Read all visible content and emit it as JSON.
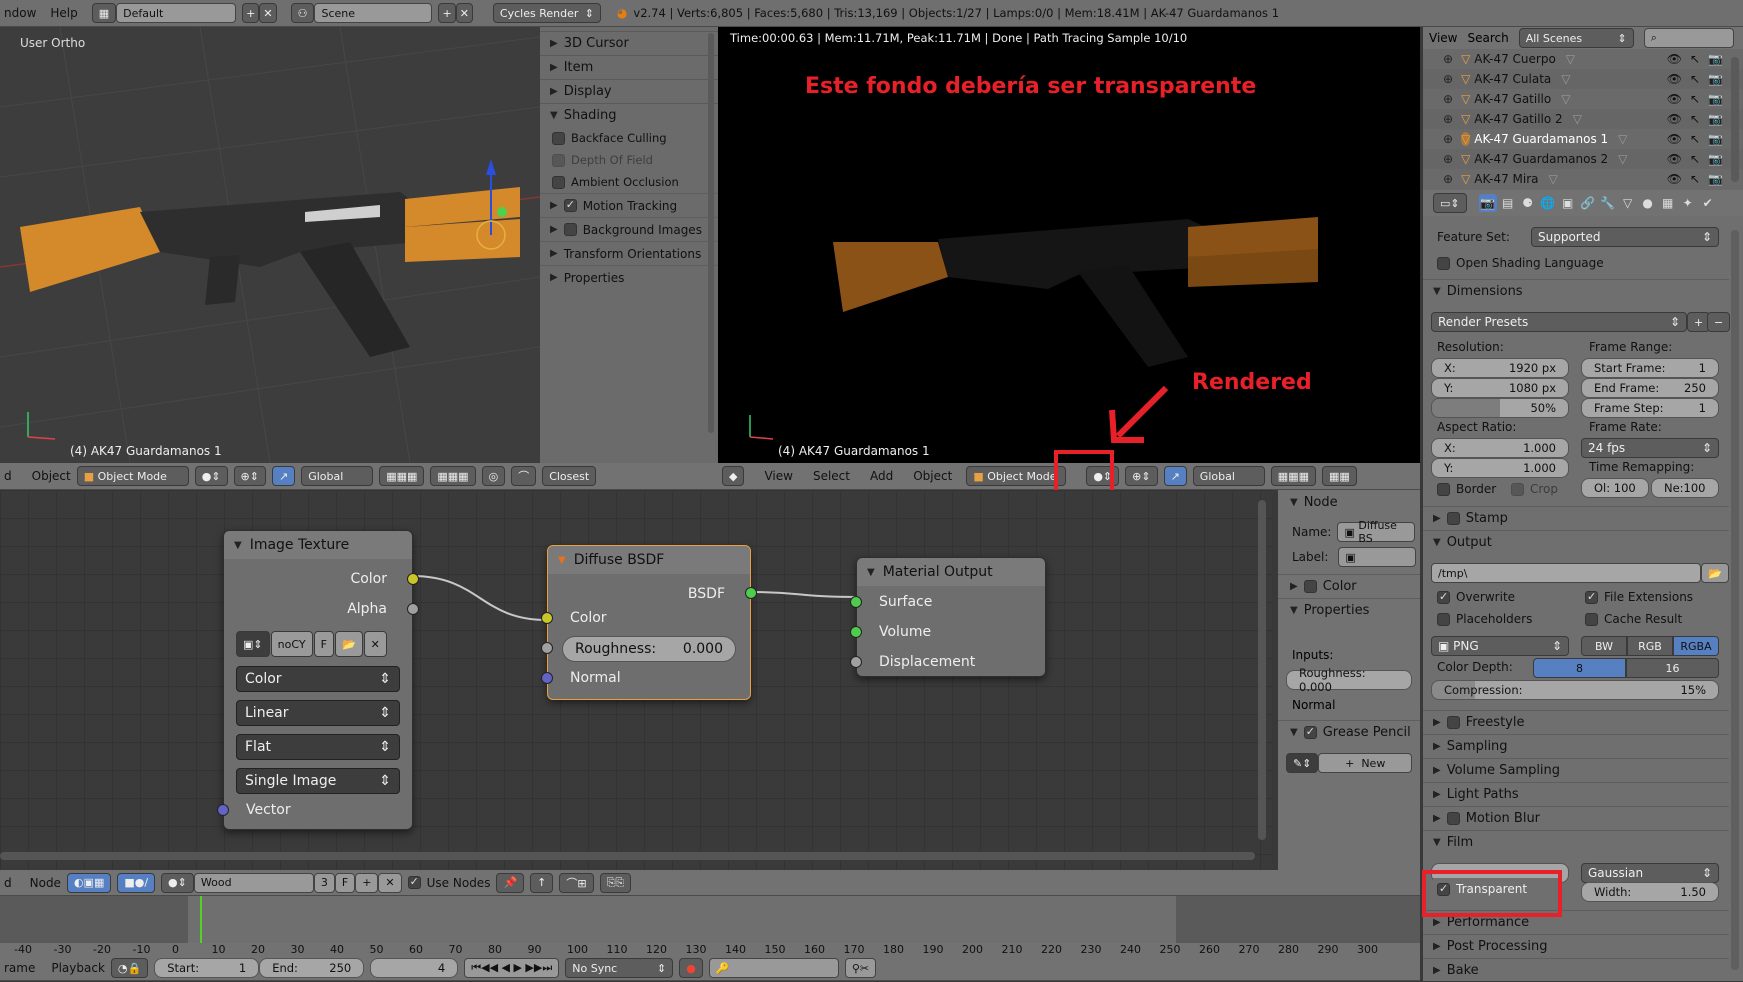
{
  "topbar": {
    "menu": [
      "ndow",
      "Help"
    ],
    "screen_layout": "Default",
    "scene": "Scene",
    "engine": "Cycles Render",
    "stats": "v2.74 | Verts:6,805 | Faces:5,680 | Tris:13,169 | Objects:1/27 | Lamps:0/0 | Mem:18.41M | AK-47 Guardamanos 1"
  },
  "viewport_left": {
    "view_label": "User Ortho",
    "object_label": "(4) AK47 Guardamanos 1",
    "header": {
      "menu_partial": "d",
      "object": "Object",
      "mode": "Object Mode",
      "orientation": "Global",
      "snap": "Closest"
    }
  },
  "tool_panel": {
    "sections": [
      {
        "label": "3D Cursor",
        "open": false
      },
      {
        "label": "Item",
        "open": false
      },
      {
        "label": "Display",
        "open": false
      },
      {
        "label": "Shading",
        "open": true
      }
    ],
    "shading_options": [
      {
        "label": "Backface Culling",
        "checked": false,
        "enabled": true
      },
      {
        "label": "Depth Of Field",
        "checked": false,
        "enabled": false
      },
      {
        "label": "Ambient Occlusion",
        "checked": false,
        "enabled": true
      }
    ],
    "more_sections": [
      {
        "label": "Motion Tracking",
        "checkbox": true,
        "checked": true
      },
      {
        "label": "Background Images",
        "checkbox": true,
        "checked": false
      },
      {
        "label": "Transform Orientations",
        "checkbox": false
      },
      {
        "label": "Properties",
        "checkbox": false
      }
    ]
  },
  "viewport_render": {
    "status": "Time:00:00.63 | Mem:11.71M, Peak:11.71M | Done | Path Tracing Sample 10/10",
    "object_label": "(4) AK47 Guardamanos 1",
    "header": {
      "view": "View",
      "select": "Select",
      "add": "Add",
      "object": "Object",
      "mode": "Object Mode",
      "orientation": "Global"
    }
  },
  "annotations": {
    "background_note": "Este fondo debería ser transparente",
    "rendered_note": "Rendered",
    "color": "#e8202a"
  },
  "outliner": {
    "view": "View",
    "search": "Search",
    "scope": "All Scenes",
    "items": [
      {
        "name": "AK-47 Cuerpo",
        "active": false
      },
      {
        "name": "AK-47 Culata",
        "active": false
      },
      {
        "name": "AK-47 Gatillo",
        "active": false
      },
      {
        "name": "AK-47 Gatillo 2",
        "active": false
      },
      {
        "name": "AK-47 Guardamanos 1",
        "active": true
      },
      {
        "name": "AK-47 Guardamanos 2",
        "active": false
      },
      {
        "name": "AK-47 Mira",
        "active": false
      }
    ]
  },
  "properties": {
    "feature_set_label": "Feature Set:",
    "feature_set": "Supported",
    "osl": "Open Shading Language",
    "dimensions": {
      "title": "Dimensions",
      "presets": "Render Presets",
      "resolution_label": "Resolution:",
      "res_x_label": "X:",
      "res_x": "1920 px",
      "res_y_label": "Y:",
      "res_y": "1080 px",
      "res_pct": "50%",
      "res_pct_value": 50,
      "frame_range_label": "Frame Range:",
      "start_label": "Start Frame:",
      "start": "1",
      "end_label": "End Frame:",
      "end": "250",
      "step_label": "Frame Step:",
      "step": "1",
      "aspect_label": "Aspect Ratio:",
      "asp_x": "1.000",
      "asp_y": "1.000",
      "frame_rate_label": "Frame Rate:",
      "frame_rate": "24 fps",
      "remap_label": "Time Remapping:",
      "remap_old": "Ol: 100",
      "remap_new": "Ne:100",
      "border": "Border",
      "crop": "Crop"
    },
    "stamp": "Stamp",
    "output": {
      "title": "Output",
      "path": "/tmp\\",
      "overwrite": "Overwrite",
      "file_ext": "File Extensions",
      "placeholders": "Placeholders",
      "cache": "Cache Result",
      "format": "PNG",
      "bw": "BW",
      "rgb": "RGB",
      "rgba": "RGBA",
      "depth_label": "Color Depth:",
      "depth8": "8",
      "depth16": "16",
      "compression_label": "Compression:",
      "compression": "15%",
      "compression_value": 15
    },
    "collapsed": [
      "Freestyle",
      "Sampling",
      "Volume Sampling",
      "Light Paths",
      "Motion Blur"
    ],
    "film": {
      "title": "Film",
      "filter": "Gaussian",
      "width_label": "Width:",
      "width": "1.50",
      "transparent": "Transparent"
    },
    "after": [
      "Performance",
      "Post Processing",
      "Bake"
    ]
  },
  "node_editor": {
    "image_texture": {
      "title": "Image Texture",
      "out_color": "Color",
      "out_alpha": "Alpha",
      "image": "noCY",
      "fake": "F",
      "color": "Color",
      "interp": "Linear",
      "proj": "Flat",
      "source": "Single Image",
      "vector": "Vector"
    },
    "diffuse": {
      "title": "Diffuse BSDF",
      "out": "BSDF",
      "color": "Color",
      "roughness_label": "Roughness:",
      "roughness": "0.000",
      "normal": "Normal"
    },
    "output": {
      "title": "Material Output",
      "surface": "Surface",
      "volume": "Volume",
      "displacement": "Displacement"
    },
    "sidebar": {
      "node": "Node",
      "name_label": "Name:",
      "name": "Diffuse BS",
      "label_label": "Label:",
      "color": "Color",
      "properties": "Properties",
      "inputs": "Inputs:",
      "roughness": "Roughness:  0.000",
      "normal": "Normal",
      "grease": "Grease Pencil",
      "new": "New"
    },
    "header": {
      "menu_partial": "d",
      "node": "Node",
      "material": "Wood",
      "users": "3",
      "fake": "F",
      "use_nodes": "Use Nodes"
    }
  },
  "timeline": {
    "ticks": [
      "-40",
      "-30",
      "-20",
      "-10",
      "0",
      "10",
      "20",
      "30",
      "40",
      "50",
      "60",
      "70",
      "80",
      "90",
      "100",
      "110",
      "120",
      "130",
      "140",
      "150",
      "160",
      "170",
      "180",
      "190",
      "200",
      "210",
      "220",
      "230",
      "240",
      "250",
      "260",
      "270",
      "280",
      "290",
      "300"
    ],
    "current_frame": "4",
    "header": {
      "frame_partial": "rame",
      "playback": "Playback",
      "start_label": "Start:",
      "start": "1",
      "end_label": "End:",
      "end": "250",
      "sync": "No Sync"
    }
  }
}
